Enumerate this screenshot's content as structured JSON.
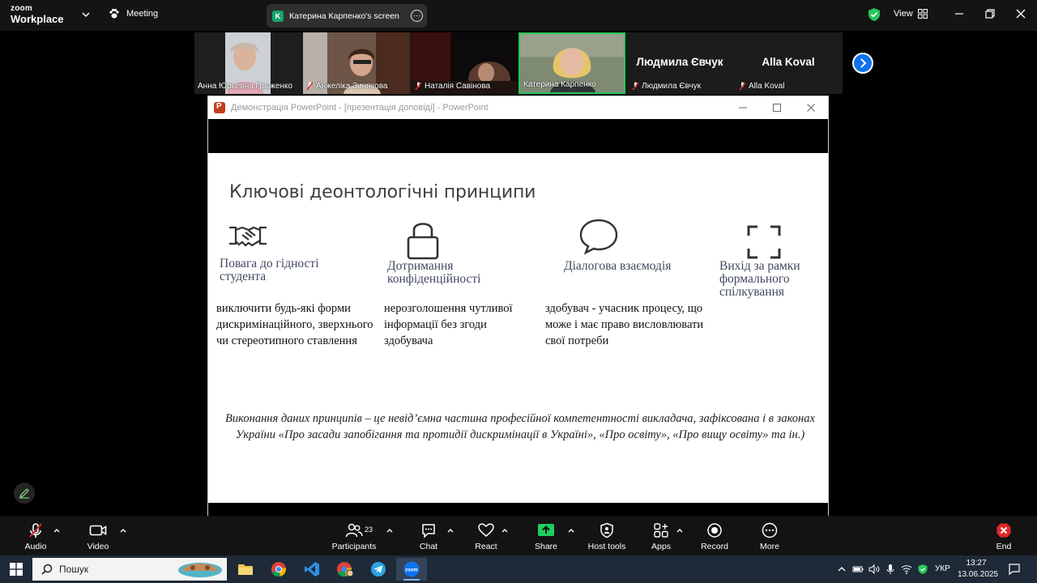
{
  "app": {
    "logo_line1": "zoom",
    "logo_line2": "Workplace",
    "meeting_label": "Meeting",
    "share_badge": "K",
    "share_label": "Катерина Карпенко's screen",
    "view_label": "View"
  },
  "participants": [
    {
      "name": "Анна Юрьевна Грыженко",
      "muted": false,
      "video": true
    },
    {
      "name": "Анжеліка Зинякова",
      "muted": true,
      "video": true
    },
    {
      "name": "Наталія Савінова",
      "muted": true,
      "video": true
    },
    {
      "name": "Катерина Карпенко",
      "muted": false,
      "video": true,
      "active": true
    },
    {
      "name": "Людмила Євчук",
      "muted": true,
      "video": false,
      "big_name": "Людмила Євчук"
    },
    {
      "name": "Alla Koval",
      "muted": true,
      "video": false,
      "big_name": "Alla Koval"
    }
  ],
  "ppt_window": {
    "title": "Демонстрація PowerPoint - [презентація доповіді] - PowerPoint"
  },
  "slide": {
    "title": "Ключові деонтологічні принципи",
    "principles": [
      {
        "icon": "handshake-icon",
        "heading": "Повага до гідності студента",
        "body": "виключити будь-які форми дискримінаційного, зверхнього чи стереотипного ставлення"
      },
      {
        "icon": "lock-icon",
        "heading": "Дотримання конфіденційності",
        "body": "нерозголошення чутливої інформації без згоди здобувача"
      },
      {
        "icon": "speech-bubble-icon",
        "heading": "Діалогова взаємодія",
        "body": "здобувач - учасник процесу, що може і має право висловлювати свої потреби"
      },
      {
        "icon": "expand-icon",
        "heading": "Вихід за рамки формального спілкування",
        "body": ""
      }
    ],
    "footer": "Виконання даних принципів – це невід’ємна частина професійної компетентності викладача, зафіксована і в законах України «Про засади запобігання та протидії дискримінації в Україні», «Про освіту», «Про вищу освіту» та ін.)"
  },
  "toolbar": {
    "audio": "Audio",
    "video": "Video",
    "participants": "Participants",
    "participants_count": "23",
    "chat": "Chat",
    "react": "React",
    "share": "Share",
    "host_tools": "Host tools",
    "apps": "Apps",
    "record": "Record",
    "more": "More",
    "end": "End"
  },
  "taskbar": {
    "search_placeholder": "Пошук",
    "language": "УКР",
    "time": "13:27",
    "date": "13.06.2025"
  },
  "colors": {
    "zoom_blue": "#0e72ed",
    "active_green": "#27c65a",
    "share_green": "#1aa36b",
    "end_red": "#e02828",
    "slide_heading": "#3f4a5e"
  }
}
